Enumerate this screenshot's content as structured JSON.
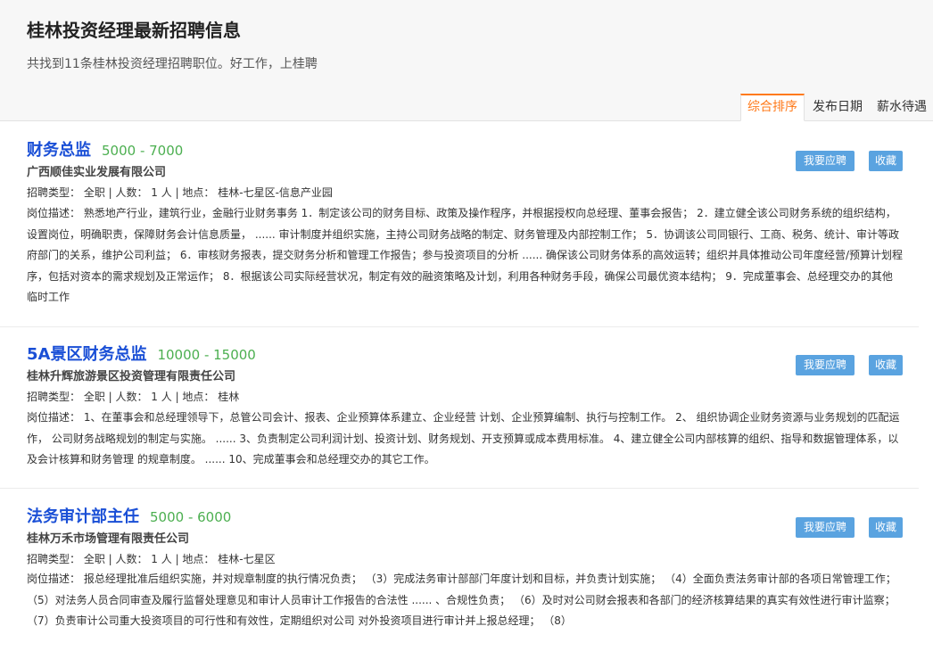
{
  "header": {
    "title": "桂林投资经理最新招聘信息",
    "subtitle": "共找到11条桂林投资经理招聘职位。好工作，上桂聘"
  },
  "sort_tabs": [
    {
      "label": "综合排序",
      "active": true
    },
    {
      "label": "发布日期",
      "active": false
    },
    {
      "label": "薪水待遇",
      "active": false
    }
  ],
  "jobs": [
    {
      "title": "财务总监",
      "salary": "5000 - 7000",
      "company": "广西顺佳实业发展有限公司",
      "meta": "招聘类型： 全职 | 人数： 1 人 | 地点： 桂林-七星区-信息产业园",
      "description": "岗位描述： 熟悉地产行业，建筑行业，金融行业财务事务 1．制定该公司的财务目标、政策及操作程序，并根据授权向总经理、董事会报告； 2．建立健全该公司财务系统的组织结构，设置岗位，明确职责，保障财务会计信息质量， ...... 审计制度并组织实施，主持公司财务战略的制定、财务管理及内部控制工作； 5．协调该公司同银行、工商、税务、统计、审计等政府部门的关系，维护公司利益； 6．审核财务报表，提交财务分析和管理工作报告；参与投资项目的分析 ...... 确保该公司财务体系的高效运转；组织并具体推动公司年度经营/预算计划程序，包括对资本的需求规划及正常运作； 8．根据该公司实际经营状况，制定有效的融资策略及计划，利用各种财务手段，确保公司最优资本结构； 9．完成董事会、总经理交办的其他临时工作",
      "apply_label": "我要应聘",
      "fav_label": "收藏"
    },
    {
      "title": "5A景区财务总监",
      "salary": "10000 - 15000",
      "company": "桂林升辉旅游景区投资管理有限责任公司",
      "meta": "招聘类型： 全职 | 人数： 1 人 | 地点： 桂林",
      "description": "岗位描述： 1、在董事会和总经理领导下，总管公司会计、报表、企业预算体系建立、企业经营 计划、企业预算编制、执行与控制工作。 2、 组织协调企业财务资源与业务规划的匹配运作， 公司财务战略规划的制定与实施。 ...... 3、负责制定公司利润计划、投资计划、财务规划、开支预算或成本费用标准。 4、建立健全公司内部核算的组织、指导和数据管理体系，以及会计核算和财务管理 的规章制度。 ...... 10、完成董事会和总经理交办的其它工作。",
      "apply_label": "我要应聘",
      "fav_label": "收藏"
    },
    {
      "title": "法务审计部主任",
      "salary": "5000 - 6000",
      "company": "桂林万禾市场管理有限责任公司",
      "meta": "招聘类型： 全职 | 人数： 1 人 | 地点： 桂林-七星区",
      "description": "岗位描述： 报总经理批准后组织实施，并对规章制度的执行情况负责； （3）完成法务审计部部门年度计划和目标，并负责计划实施； （4）全面负责法务审计部的各项日常管理工作； （5）对法务人员合同审查及履行监督处理意见和审计人员审计工作报告的合法性 ...... 、合规性负责； （6）及时对公司财会报表和各部门的经济核算结果的真实有效性进行审计监察； （7）负责审计公司重大投资项目的可行性和有效性，定期组织对公司 对外投资项目进行审计并上报总经理； （8）",
      "apply_label": "我要应聘",
      "fav_label": "收藏"
    }
  ]
}
